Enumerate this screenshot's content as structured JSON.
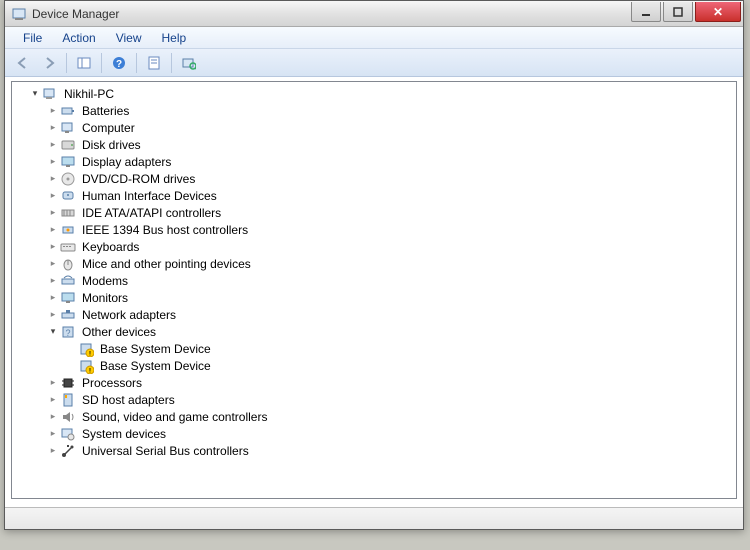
{
  "window": {
    "title": "Device Manager"
  },
  "menu": {
    "file": "File",
    "action": "Action",
    "view": "View",
    "help": "Help"
  },
  "tree": {
    "root": "Nikhil-PC",
    "items": [
      {
        "label": "Batteries",
        "icon": "battery"
      },
      {
        "label": "Computer",
        "icon": "computer"
      },
      {
        "label": "Disk drives",
        "icon": "disk"
      },
      {
        "label": "Display adapters",
        "icon": "display"
      },
      {
        "label": "DVD/CD-ROM drives",
        "icon": "cdrom"
      },
      {
        "label": "Human Interface Devices",
        "icon": "hid"
      },
      {
        "label": "IDE ATA/ATAPI controllers",
        "icon": "ide"
      },
      {
        "label": "IEEE 1394 Bus host controllers",
        "icon": "ieee"
      },
      {
        "label": "Keyboards",
        "icon": "keyboard"
      },
      {
        "label": "Mice and other pointing devices",
        "icon": "mouse"
      },
      {
        "label": "Modems",
        "icon": "modem"
      },
      {
        "label": "Monitors",
        "icon": "monitor"
      },
      {
        "label": "Network adapters",
        "icon": "network"
      },
      {
        "label": "Other devices",
        "icon": "other",
        "expanded": true,
        "children": [
          {
            "label": "Base System Device",
            "icon": "warn"
          },
          {
            "label": "Base System Device",
            "icon": "warn"
          }
        ]
      },
      {
        "label": "Processors",
        "icon": "cpu"
      },
      {
        "label": "SD host adapters",
        "icon": "sd"
      },
      {
        "label": "Sound, video and game controllers",
        "icon": "sound"
      },
      {
        "label": "System devices",
        "icon": "system"
      },
      {
        "label": "Universal Serial Bus controllers",
        "icon": "usb"
      }
    ]
  }
}
